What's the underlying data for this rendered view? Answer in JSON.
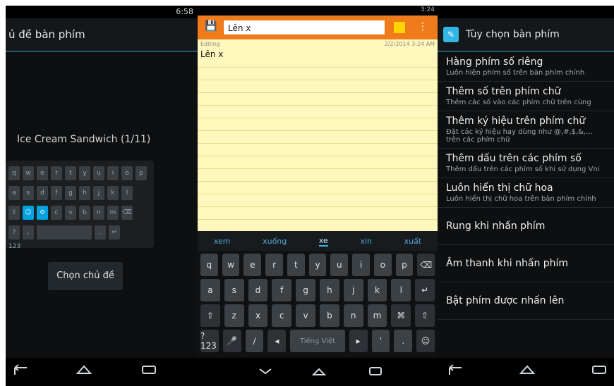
{
  "left": {
    "title": "ủ đề bàn phím",
    "theme_name": "Ice Cream Sandwich (1/11)",
    "choose_button": "Chọn chủ đề",
    "status_time": "6:58"
  },
  "middle": {
    "note_title_input": "Lên x",
    "meta_left": "Editing",
    "meta_right": "2/2/2014 3:24 AM",
    "note_text": "Lên x",
    "status_time": "3:24",
    "suggestions": [
      "xem",
      "xuống",
      "xe",
      "xin",
      "xuất"
    ],
    "keyboard": {
      "row1": [
        "q",
        "w",
        "e",
        "r",
        "t",
        "y",
        "u",
        "i",
        "o",
        "p",
        "⌫"
      ],
      "row2": [
        "a",
        "s",
        "d",
        "f",
        "g",
        "h",
        "j",
        "k",
        "l",
        "↵"
      ],
      "row3": [
        "⇧",
        "z",
        "x",
        "c",
        "v",
        "b",
        "n",
        "m",
        "⌘",
        "⇧"
      ],
      "row4": [
        "?123",
        "🎤",
        "/",
        "◂",
        "Tiếng Việt",
        "▸",
        "'",
        ".",
        "☺"
      ]
    }
  },
  "right": {
    "title": "Tùy chọn bàn phím",
    "items": [
      {
        "title": "Hàng phím số riêng",
        "subtitle": "Luôn hiện phím số trên bàn phím chính"
      },
      {
        "title": "Thêm số trên phím chữ",
        "subtitle": "Thêm các số vào các phím chữ trên cùng"
      },
      {
        "title": "Thêm ký hiệu trên phím chữ",
        "subtitle": "Đặt các ký hiệu hay dùng như @,#,$,&,... trên các phím chữ"
      },
      {
        "title": "Thêm dấu trên các phím số",
        "subtitle": "Thêm dấu trên các phím số khi sử dụng Vni"
      },
      {
        "title": "Luôn hiển thị chữ hoa",
        "subtitle": "Luôn hiển thị chữ hoa trên bàn phím chính"
      },
      {
        "title": "Rung khi nhấn phím",
        "subtitle": ""
      },
      {
        "title": "Âm thanh khi nhấn phím",
        "subtitle": ""
      },
      {
        "title": "Bật phím được nhấn lên",
        "subtitle": ""
      }
    ]
  }
}
